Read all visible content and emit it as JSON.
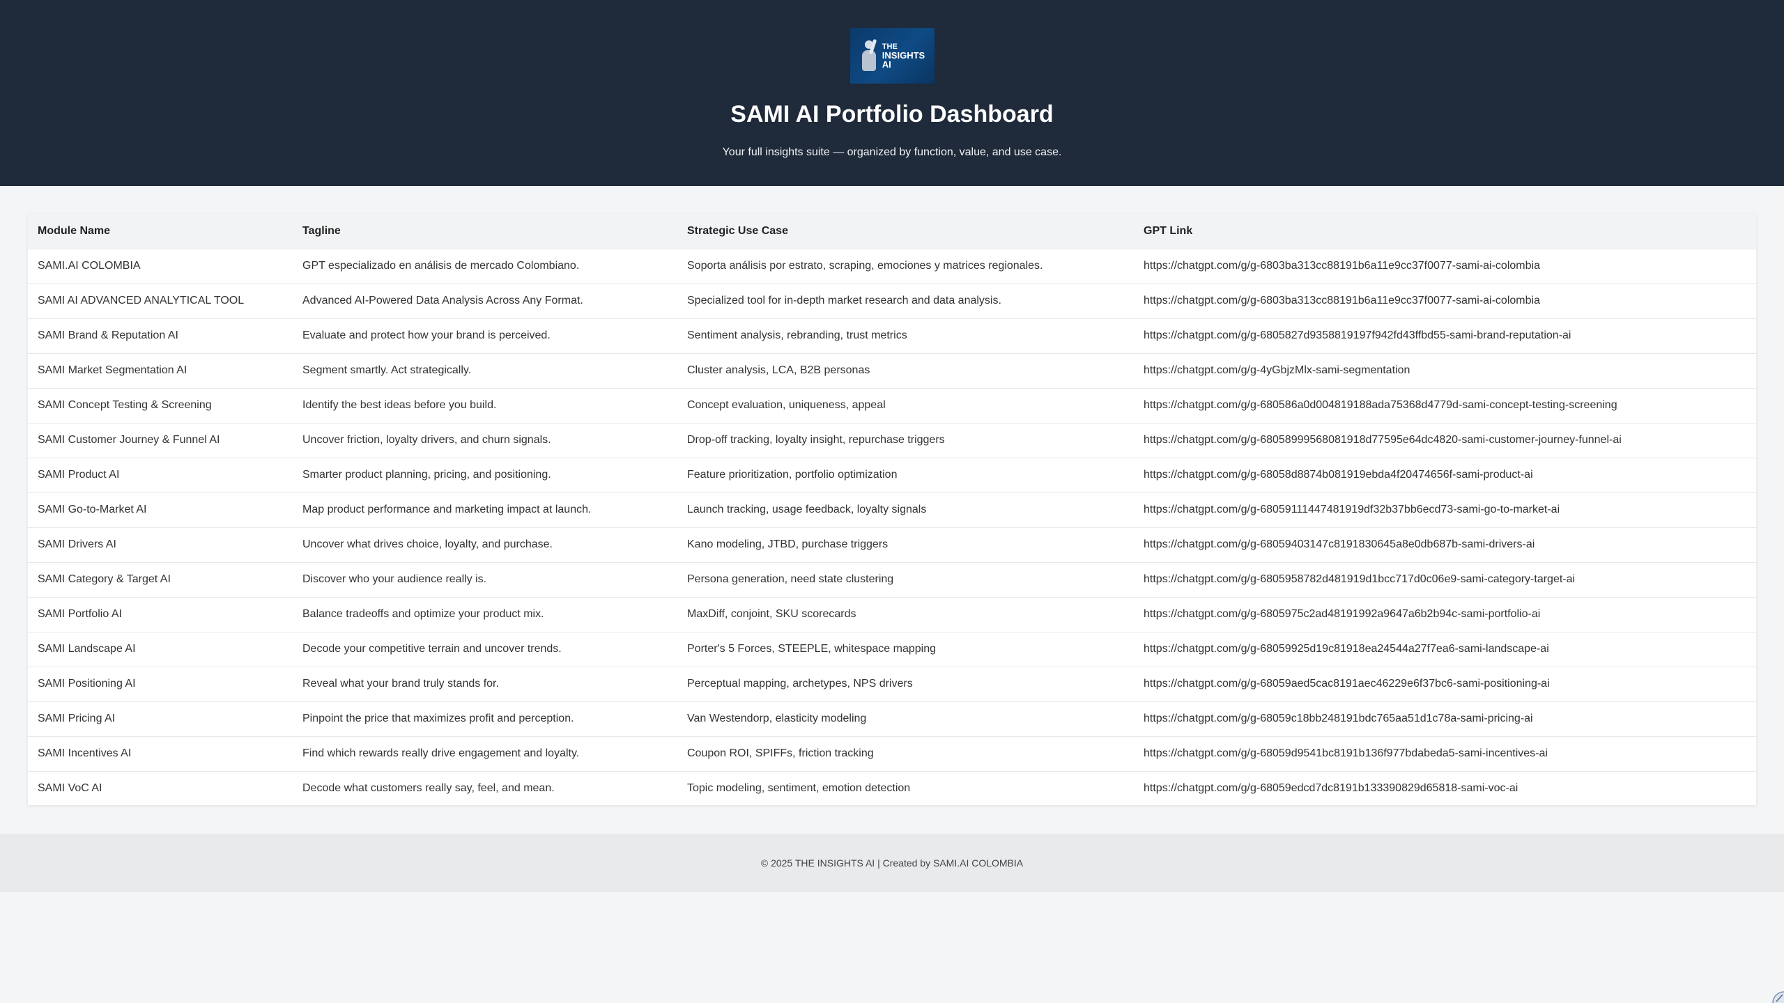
{
  "header": {
    "logo_text_line1": "THE",
    "logo_text_line2": "INSIGHTS",
    "logo_text_line3": "AI",
    "title": "SAMI AI Portfolio Dashboard",
    "subtitle": "Your full insights suite — organized by function, value, and use case."
  },
  "table": {
    "headers": [
      "Module Name",
      "Tagline",
      "Strategic Use Case",
      "GPT Link"
    ],
    "rows": [
      {
        "name": "SAMI.AI COLOMBIA",
        "tagline": "GPT especializado en análisis de mercado Colombiano.",
        "use_case": "Soporta análisis por estrato, scraping, emociones y matrices regionales.",
        "link": "https://chatgpt.com/g/g-6803ba313cc88191b6a11e9cc37f0077-sami-ai-colombia"
      },
      {
        "name": "SAMI AI ADVANCED ANALYTICAL TOOL",
        "tagline": "Advanced AI-Powered Data Analysis Across Any Format.",
        "use_case": "Specialized tool for in-depth market research and data analysis.",
        "link": "https://chatgpt.com/g/g-6803ba313cc88191b6a11e9cc37f0077-sami-ai-colombia"
      },
      {
        "name": "SAMI Brand & Reputation AI",
        "tagline": "Evaluate and protect how your brand is perceived.",
        "use_case": "Sentiment analysis, rebranding, trust metrics",
        "link": "https://chatgpt.com/g/g-6805827d9358819197f942fd43ffbd55-sami-brand-reputation-ai"
      },
      {
        "name": "SAMI Market Segmentation AI",
        "tagline": "Segment smartly. Act strategically.",
        "use_case": "Cluster analysis, LCA, B2B personas",
        "link": "https://chatgpt.com/g/g-4yGbjzMlx-sami-segmentation"
      },
      {
        "name": "SAMI Concept Testing & Screening",
        "tagline": "Identify the best ideas before you build.",
        "use_case": "Concept evaluation, uniqueness, appeal",
        "link": "https://chatgpt.com/g/g-680586a0d004819188ada75368d4779d-sami-concept-testing-screening"
      },
      {
        "name": "SAMI Customer Journey & Funnel AI",
        "tagline": "Uncover friction, loyalty drivers, and churn signals.",
        "use_case": "Drop-off tracking, loyalty insight, repurchase triggers",
        "link": "https://chatgpt.com/g/g-68058999568081918d77595e64dc4820-sami-customer-journey-funnel-ai"
      },
      {
        "name": "SAMI Product AI",
        "tagline": "Smarter product planning, pricing, and positioning.",
        "use_case": "Feature prioritization, portfolio optimization",
        "link": "https://chatgpt.com/g/g-68058d8874b081919ebda4f20474656f-sami-product-ai"
      },
      {
        "name": "SAMI Go-to-Market AI",
        "tagline": "Map product performance and marketing impact at launch.",
        "use_case": "Launch tracking, usage feedback, loyalty signals",
        "link": "https://chatgpt.com/g/g-68059111447481919df32b37bb6ecd73-sami-go-to-market-ai"
      },
      {
        "name": "SAMI Drivers AI",
        "tagline": "Uncover what drives choice, loyalty, and purchase.",
        "use_case": "Kano modeling, JTBD, purchase triggers",
        "link": "https://chatgpt.com/g/g-68059403147c8191830645a8e0db687b-sami-drivers-ai"
      },
      {
        "name": "SAMI Category & Target AI",
        "tagline": "Discover who your audience really is.",
        "use_case": "Persona generation, need state clustering",
        "link": "https://chatgpt.com/g/g-6805958782d481919d1bcc717d0c06e9-sami-category-target-ai"
      },
      {
        "name": "SAMI Portfolio AI",
        "tagline": "Balance tradeoffs and optimize your product mix.",
        "use_case": "MaxDiff, conjoint, SKU scorecards",
        "link": "https://chatgpt.com/g/g-6805975c2ad48191992a9647a6b2b94c-sami-portfolio-ai"
      },
      {
        "name": "SAMI Landscape AI",
        "tagline": "Decode your competitive terrain and uncover trends.",
        "use_case": "Porter's 5 Forces, STEEPLE, whitespace mapping",
        "link": "https://chatgpt.com/g/g-68059925d19c81918ea24544a27f7ea6-sami-landscape-ai"
      },
      {
        "name": "SAMI Positioning AI",
        "tagline": "Reveal what your brand truly stands for.",
        "use_case": "Perceptual mapping, archetypes, NPS drivers",
        "link": "https://chatgpt.com/g/g-68059aed5cac8191aec46229e6f37bc6-sami-positioning-ai"
      },
      {
        "name": "SAMI Pricing AI",
        "tagline": "Pinpoint the price that maximizes profit and perception.",
        "use_case": "Van Westendorp, elasticity modeling",
        "link": "https://chatgpt.com/g/g-68059c18bb248191bdc765aa51d1c78a-sami-pricing-ai"
      },
      {
        "name": "SAMI Incentives AI",
        "tagline": "Find which rewards really drive engagement and loyalty.",
        "use_case": "Coupon ROI, SPIFFs, friction tracking",
        "link": "https://chatgpt.com/g/g-68059d9541bc8191b136f977bdabeda5-sami-incentives-ai"
      },
      {
        "name": "SAMI VoC AI",
        "tagline": "Decode what customers really say, feel, and mean.",
        "use_case": "Topic modeling, sentiment, emotion detection",
        "link": "https://chatgpt.com/g/g-68059edcd7dc8191b133390829d65818-sami-voc-ai"
      }
    ]
  },
  "footer": {
    "text": "© 2025 THE INSIGHTS AI | Created by SAMI.AI COLOMBIA"
  },
  "icons": {
    "logo": "insights-ai-logo",
    "corner": "resize-corner-icon"
  },
  "colors": {
    "header_bg": "#1f2a3a",
    "page_bg": "#f4f5f7",
    "footer_bg": "#e9eaec",
    "logo_bg": "#0f4a84"
  }
}
